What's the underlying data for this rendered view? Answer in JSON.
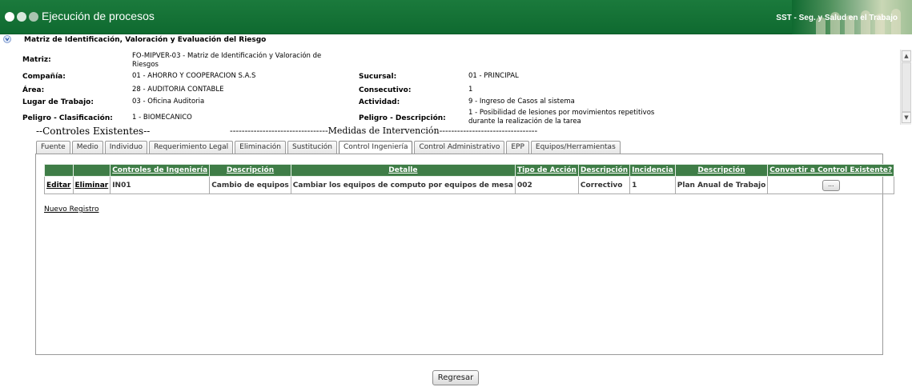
{
  "header": {
    "app_title": "Ejecución de procesos",
    "brand": "SST - Seg. y Salud en el Trabajo"
  },
  "page": {
    "title": "Matriz de Identificación, Valoración y Evaluación del Riesgo"
  },
  "info": {
    "matriz_label": "Matriz:",
    "matriz_value": "FO-MIPVER-03 - Matriz de Identificación y Valoración de Riesgos",
    "compania_label": "Compañía:",
    "compania_value": "01 - AHORRO Y COOPERACION S.A.S",
    "sucursal_label": "Sucursal:",
    "sucursal_value": "01 - PRINCIPAL",
    "area_label": "Área:",
    "area_value": "28 - AUDITORIA CONTABLE",
    "consecutivo_label": "Consecutivo:",
    "consecutivo_value": "1",
    "lugar_label": "Lugar de Trabajo:",
    "lugar_value": "03 - Oficina Auditoria",
    "actividad_label": "Actividad:",
    "actividad_value": "9 - Ingreso de Casos al sistema",
    "peligro_clas_label": "Peligro - Clasificación:",
    "peligro_clas_value": "1 - BIOMECANICO",
    "peligro_desc_label": "Peligro - Descripción:",
    "peligro_desc_value": "1 - Posibilidad de lesiones por movimientos repetitivos durante la realización de la tarea"
  },
  "sections": {
    "controles": "--Controles Existentes--",
    "medidas": "---------------------------------Medidas de Intervención---------------------------------"
  },
  "tabs": [
    {
      "label": "Fuente"
    },
    {
      "label": "Medio"
    },
    {
      "label": "Individuo"
    },
    {
      "label": "Requerimiento Legal"
    },
    {
      "label": "Eliminación"
    },
    {
      "label": "Sustitución"
    },
    {
      "label": "Control Ingeniería"
    },
    {
      "label": "Control Administrativo"
    },
    {
      "label": "EPP"
    },
    {
      "label": "Equipos/Herramientas"
    }
  ],
  "active_tab": "Control Ingeniería",
  "table": {
    "headers": [
      "",
      "",
      "Controles de Ingeniería",
      "Descripción",
      "Detalle",
      "Tipo de Acción",
      "Descripción",
      "Incidencia",
      "Descripción",
      "Convertir a Control Existente?"
    ],
    "rows": [
      {
        "edit": "Editar",
        "delete": "Eliminar",
        "control": "IN01",
        "descripcion": "Cambio de equipos",
        "detalle": "Cambiar los equipos de computo por equipos de mesa",
        "tipo_accion": "002",
        "tipo_desc": "Correctivo",
        "incidencia": "1",
        "incidencia_desc": "Plan Anual de Trabajo",
        "convert_button": "..."
      }
    ]
  },
  "links": {
    "new_record": "Nuevo Registro"
  },
  "buttons": {
    "back": "Regresar"
  },
  "colors": {
    "header_green": "#0f6a30",
    "table_header": "#3f7d47"
  }
}
